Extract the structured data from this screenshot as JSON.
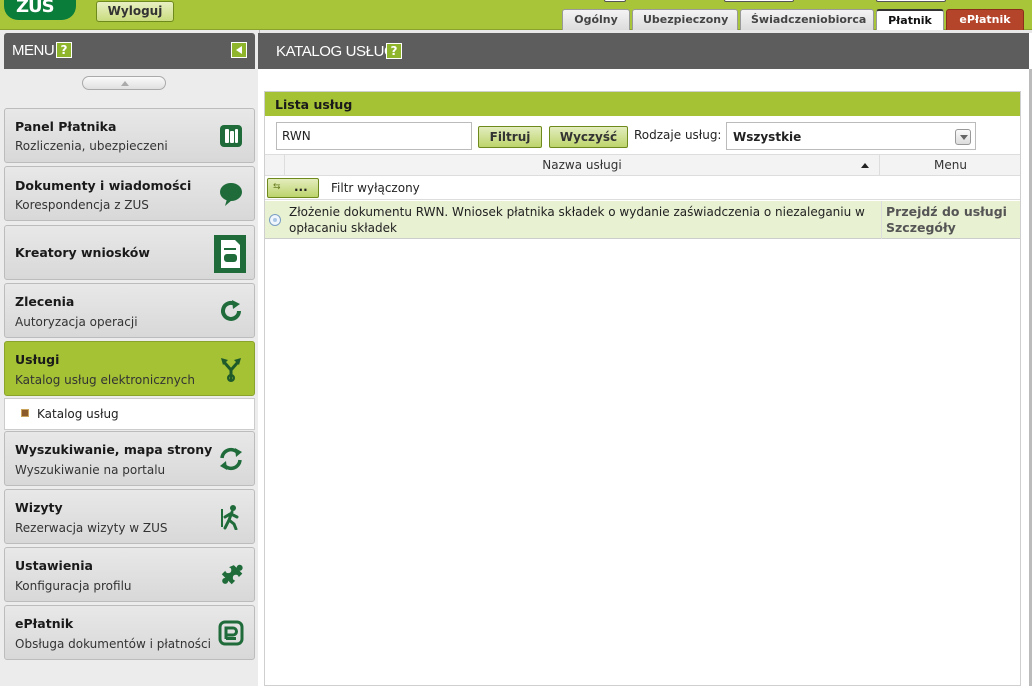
{
  "topbar": {
    "logo_text": "ZUS",
    "logout_label": "Wyloguj",
    "tabs": [
      {
        "label": "Ogólny"
      },
      {
        "label": "Ubezpieczony"
      },
      {
        "label": "Świadczeniobiorca"
      },
      {
        "label": "Płatnik"
      },
      {
        "label": "ePłatnik"
      }
    ],
    "active_tab": "Płatnik"
  },
  "sidebar": {
    "title": "MENU",
    "help_glyph": "?",
    "items": [
      {
        "title": "Panel Płatnika",
        "subtitle": "Rozliczenia, ubezpieczeni",
        "icon": "coins-icon"
      },
      {
        "title": "Dokumenty i wiadomości",
        "subtitle": "Korespondencja z ZUS",
        "icon": "speech-bubble-icon"
      },
      {
        "title": "Kreatory wniosków",
        "subtitle": "",
        "icon": "document-form-icon"
      },
      {
        "title": "Zlecenia",
        "subtitle": "Autoryzacja operacji",
        "icon": "refresh-icon"
      },
      {
        "title": "Usługi",
        "subtitle": "Katalog usług elektronicznych",
        "icon": "fork-arrows-icon"
      },
      {
        "title": "Wyszukiwanie, mapa strony",
        "subtitle": "Wyszukiwanie na portalu",
        "icon": "sync-icon"
      },
      {
        "title": "Wizyty",
        "subtitle": "Rezerwacja wizyty w ZUS",
        "icon": "walking-person-icon"
      },
      {
        "title": "Ustawienia",
        "subtitle": "Konfiguracja profilu",
        "icon": "puzzle-icon"
      },
      {
        "title": "ePłatnik",
        "subtitle": "Obsługa dokumentów i płatności",
        "icon": "eplatnik-icon"
      }
    ],
    "active_item": "Usługi",
    "submenu": {
      "label": "Katalog usług"
    }
  },
  "main": {
    "title": "KATALOG USŁUG",
    "help_glyph": "?",
    "panel": {
      "title": "Lista usług",
      "search_value": "RWN",
      "filter_button": "Filtruj",
      "clear_button": "Wyczyść",
      "type_label": "Rodzaje usług:",
      "type_selected": "Wszystkie",
      "columns": {
        "name": "Nazwa usługi",
        "menu": "Menu"
      },
      "filter_toggle_label": "...",
      "filter_status": "Filtr wyłączony",
      "rows": [
        {
          "name": "Złożenie dokumentu RWN. Wniosek płatnika składek o wydanie zaświadczenia o niezaleganiu w opłacaniu składek",
          "links": [
            "Przejdź do usługi",
            "Szczegóły"
          ]
        }
      ]
    }
  },
  "colors": {
    "accent_green": "#a4c234",
    "header_gray": "#5d5d5d",
    "eplatnik_tab": "#b5452a",
    "logo_green": "#0a7d3a",
    "row_highlight": "#e8f1d2"
  }
}
